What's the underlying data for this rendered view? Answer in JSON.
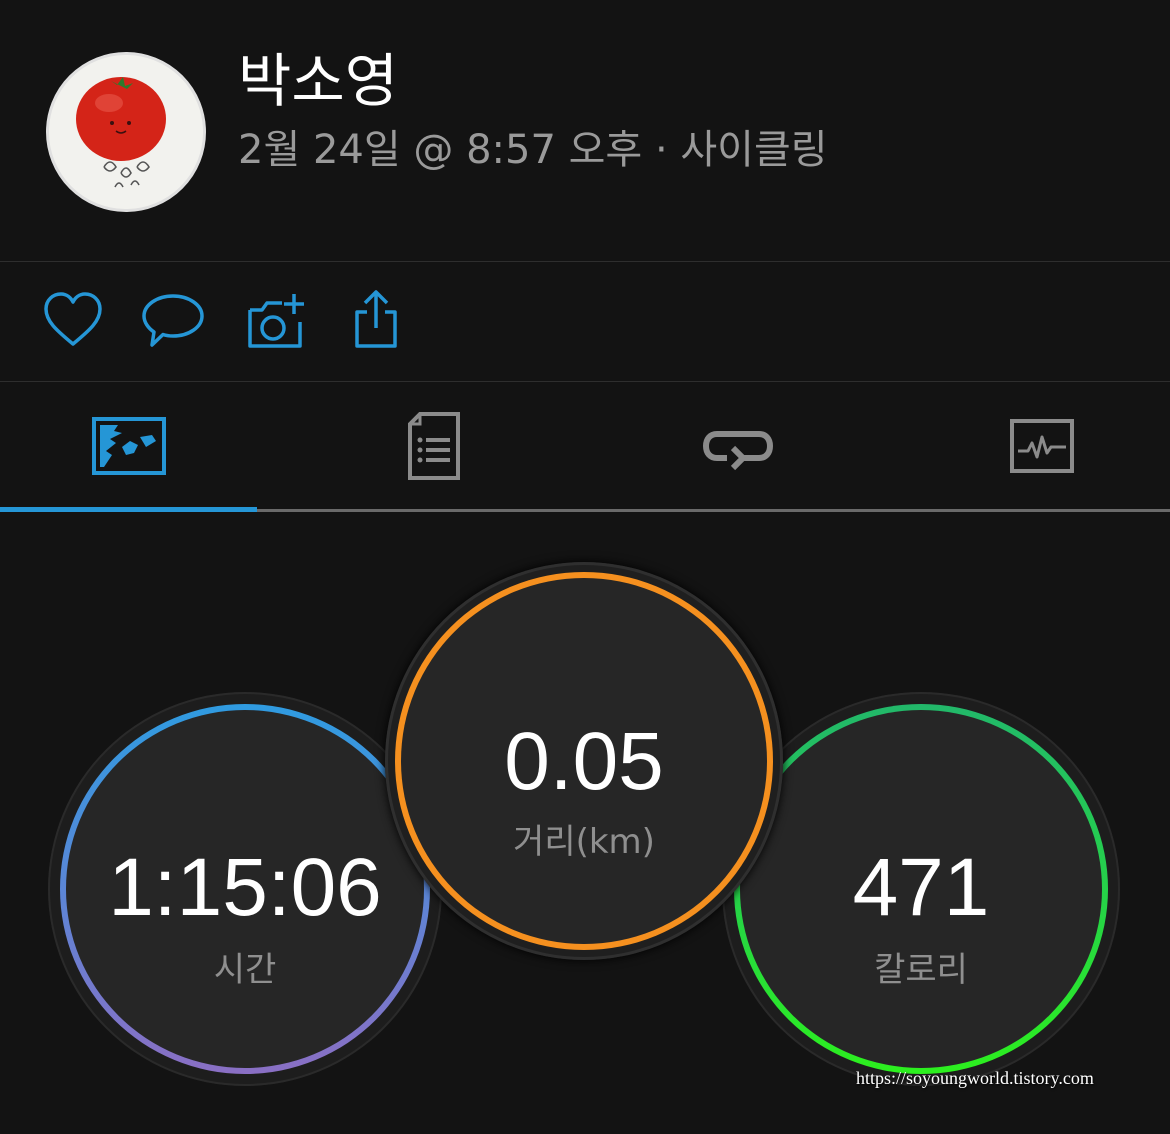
{
  "profile": {
    "name": "박소영",
    "meta": "2월 24일 @ 8:57 오후 · 사이클링",
    "avatar_icon": "tomato-avatar"
  },
  "actions": [
    {
      "name": "like",
      "icon": "heart-icon"
    },
    {
      "name": "comment",
      "icon": "comment-icon"
    },
    {
      "name": "add-photo",
      "icon": "camera-plus-icon"
    },
    {
      "name": "share",
      "icon": "share-icon"
    }
  ],
  "tabs": [
    {
      "name": "overview",
      "icon": "map-overview-icon",
      "active": true
    },
    {
      "name": "details",
      "icon": "document-list-icon",
      "active": false
    },
    {
      "name": "laps",
      "icon": "loop-icon",
      "active": false
    },
    {
      "name": "charts",
      "icon": "chart-pulse-icon",
      "active": false
    }
  ],
  "colors": {
    "accent": "#2596d6",
    "time_ring_top": "#2f9be0",
    "time_ring_bottom": "#8a6fc4",
    "distance_ring": "#f5901f",
    "calories_ring_top": "#22b86a",
    "calories_ring_bottom": "#2cf01e"
  },
  "stats": {
    "time": {
      "value": "1:15:06",
      "label": "시간"
    },
    "distance": {
      "value": "0.05",
      "label": "거리(km)"
    },
    "calories": {
      "value": "471",
      "label": "칼로리"
    }
  },
  "watermark": "https://soyoungworld.tistory.com"
}
